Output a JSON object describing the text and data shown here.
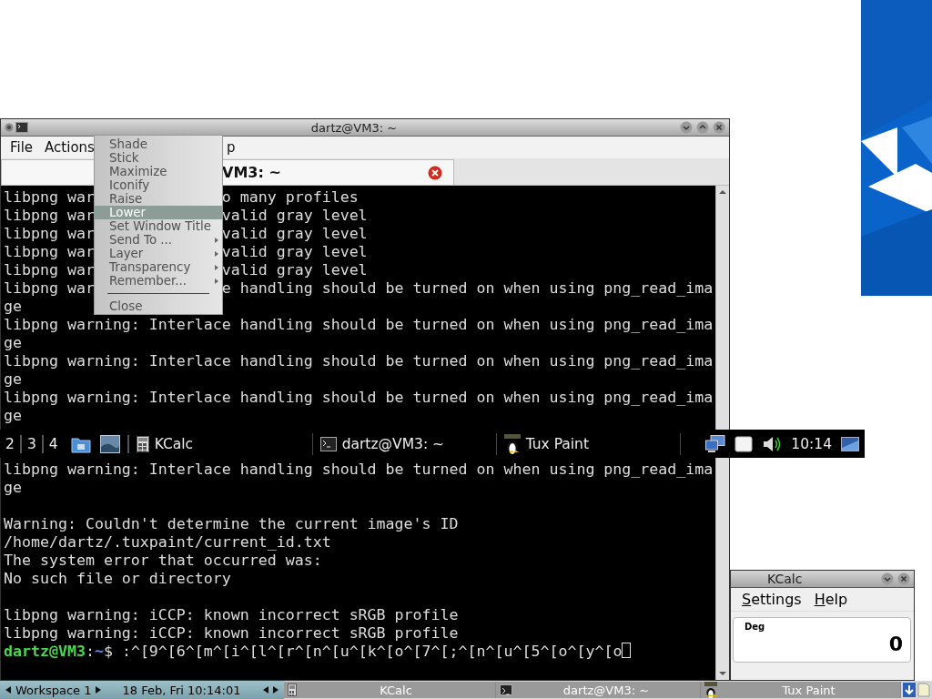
{
  "terminal_window": {
    "title": "dartz@VM3: ~",
    "menu": [
      "File",
      "Actions",
      "p"
    ],
    "tab": "VM3: ~",
    "lines": [
      {
        "kind": "split",
        "left": "libpng war",
        "right": "o many profiles"
      },
      {
        "kind": "split",
        "left": "libpng war",
        "right": "valid gray level"
      },
      {
        "kind": "split",
        "left": "libpng war",
        "right": "valid gray level"
      },
      {
        "kind": "split",
        "left": "libpng war",
        "right": "valid gray level"
      },
      {
        "kind": "split",
        "left": "libpng war",
        "right": "valid gray level"
      },
      {
        "kind": "split",
        "left": "libpng war",
        "right": "e handling should be turned on when using png_read_ima"
      },
      {
        "kind": "text",
        "text": "ge"
      },
      {
        "kind": "text",
        "text": "libpng warning: Interlace handling should be turned on when using png_read_ima"
      },
      {
        "kind": "text",
        "text": "ge"
      },
      {
        "kind": "text",
        "text": "libpng warning: Interlace handling should be turned on when using png_read_ima"
      },
      {
        "kind": "text",
        "text": "ge"
      },
      {
        "kind": "text",
        "text": "libpng warning: Interlace handling should be turned on when using png_read_ima"
      },
      {
        "kind": "text",
        "text": "ge"
      }
    ],
    "lines_lower": [
      {
        "kind": "text",
        "text": "libpng warning: Interlace handling should be turned on when using png_read_ima"
      },
      {
        "kind": "text",
        "text": "ge"
      },
      {
        "kind": "blank"
      },
      {
        "kind": "text",
        "text": "Warning: Couldn't determine the current image's ID"
      },
      {
        "kind": "text",
        "text": "/home/dartz/.tuxpaint/current_id.txt"
      },
      {
        "kind": "text",
        "text": "The system error that occurred was:"
      },
      {
        "kind": "text",
        "text": "No such file or directory"
      },
      {
        "kind": "blank"
      },
      {
        "kind": "text",
        "text": "libpng warning: iCCP: known incorrect sRGB profile"
      },
      {
        "kind": "text",
        "text": "libpng warning: iCCP: known incorrect sRGB profile"
      },
      {
        "kind": "prompt",
        "user": "dartz@VM3",
        "sep": ":",
        "path": "~",
        "command": "$ :^[9^[6^[m^[i^[l^[r^[n^[u^[k^[o^[7^[;^[n^[u^[5^[o^[y^[o"
      }
    ]
  },
  "window_menu": {
    "items": [
      {
        "kind": "item",
        "label": "Shade",
        "selected": false,
        "submenu": false
      },
      {
        "kind": "item",
        "label": "Stick",
        "selected": false,
        "submenu": false
      },
      {
        "kind": "item",
        "label": "Maximize",
        "selected": false,
        "submenu": false
      },
      {
        "kind": "item",
        "label": "Iconify",
        "selected": false,
        "submenu": false
      },
      {
        "kind": "item",
        "label": "Raise",
        "selected": false,
        "submenu": false
      },
      {
        "kind": "item",
        "label": "Lower",
        "selected": true,
        "submenu": false
      },
      {
        "kind": "item",
        "label": "Set Window Title",
        "selected": false,
        "submenu": false
      },
      {
        "kind": "item",
        "label": "Send To ...",
        "selected": false,
        "submenu": true
      },
      {
        "kind": "item",
        "label": "Layer",
        "selected": false,
        "submenu": true
      },
      {
        "kind": "item",
        "label": "Transparency",
        "selected": false,
        "submenu": true
      },
      {
        "kind": "item",
        "label": "Remember...",
        "selected": false,
        "submenu": true
      },
      {
        "kind": "separator"
      },
      {
        "kind": "item",
        "label": "Close",
        "selected": false,
        "submenu": false
      }
    ]
  },
  "taskbar": {
    "workspaces": [
      "2",
      "3",
      "4"
    ],
    "tasks": [
      {
        "kind": "calculator",
        "label": "KCalc"
      },
      {
        "kind": "terminal",
        "label": "dartz@VM3: ~"
      },
      {
        "kind": "tuxpaint",
        "label": "Tux Paint"
      }
    ],
    "clock": "10:14"
  },
  "kcalc_window": {
    "title": "KCalc",
    "menu": [
      "Settings",
      "Help"
    ],
    "mode": "Deg",
    "display": "0"
  },
  "bottom_panel": {
    "workspace": "Workspace 1",
    "datetime": "18 Feb, Fri 10:14:01",
    "tasks": [
      {
        "kind": "calculator",
        "label": "KCalc"
      },
      {
        "kind": "terminal",
        "label": "dartz@VM3: ~"
      },
      {
        "kind": "tuxpaint",
        "label": "Tux Paint"
      }
    ]
  }
}
